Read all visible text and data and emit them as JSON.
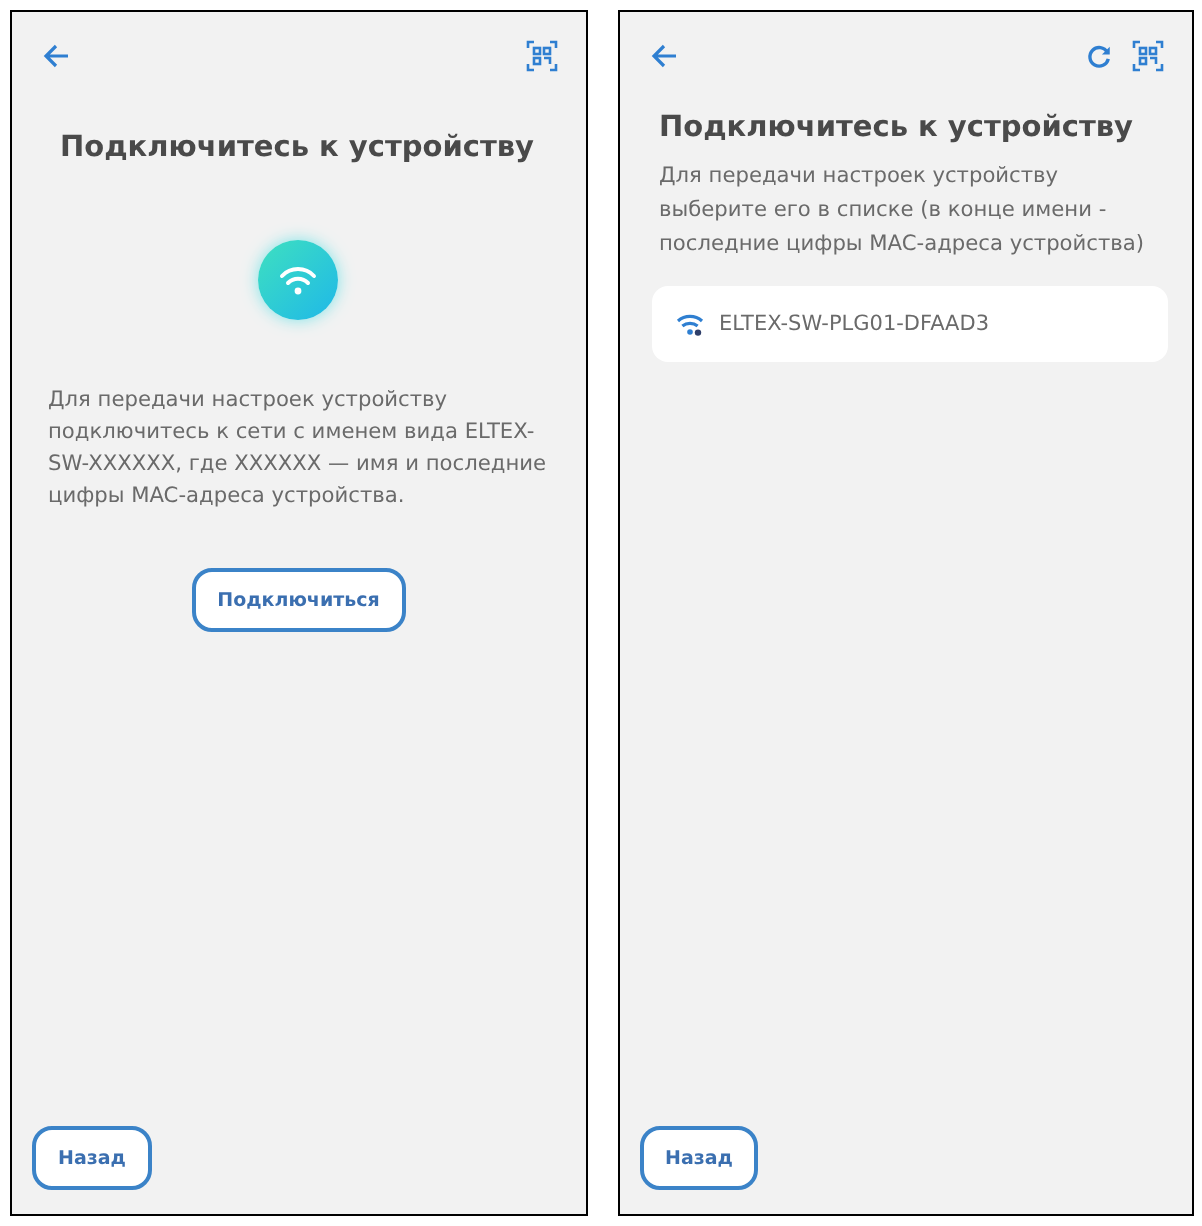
{
  "screens": [
    {
      "kind": "intro",
      "title": "Подключитесь к устройству",
      "text": "Для передачи настроек устройству подключитесь к сети с именем вида ELTEX-SW-XXXXXX, где XXXXXX — имя и последние цифры MAC-адреса устройства.",
      "connect_button": "Подключиться",
      "back_button": "Назад"
    },
    {
      "kind": "list",
      "title": "Подключитесь к устройству",
      "text": "Для передачи настроек устройству выберите его в списке (в конце имени - последние цифры MAC-адреса устройства)",
      "networks": [
        {
          "name": "ELTEX-SW-PLG01-DFAAD3"
        }
      ],
      "back_button": "Назад"
    }
  ]
}
